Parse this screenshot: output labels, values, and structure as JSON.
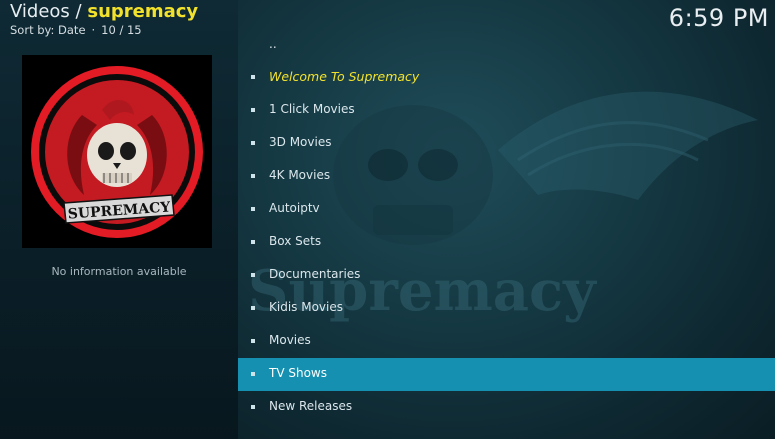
{
  "header": {
    "section": "Videos",
    "separator": "/",
    "addon": "supremacy",
    "sort_label": "Sort by: Date",
    "position": "10 / 15"
  },
  "clock": "6:59 PM",
  "thumbnail": {
    "caption": "SUPREMACY"
  },
  "info_text": "No information available",
  "background_watermark": "Supremacy",
  "list": {
    "parent": "..",
    "items": [
      {
        "label": "Welcome To Supremacy"
      },
      {
        "label": "1 Click Movies"
      },
      {
        "label": "3D Movies"
      },
      {
        "label": "4K Movies"
      },
      {
        "label": "Autoiptv"
      },
      {
        "label": "Box Sets"
      },
      {
        "label": "Documentaries"
      },
      {
        "label": "Kidis Movies"
      },
      {
        "label": "Movies"
      },
      {
        "label": "TV Shows"
      },
      {
        "label": "New Releases"
      }
    ],
    "selected_index": 9
  },
  "colors": {
    "accent_yellow": "#f2e22c",
    "selection": "#1590b0",
    "text": "#dbe7ec"
  }
}
